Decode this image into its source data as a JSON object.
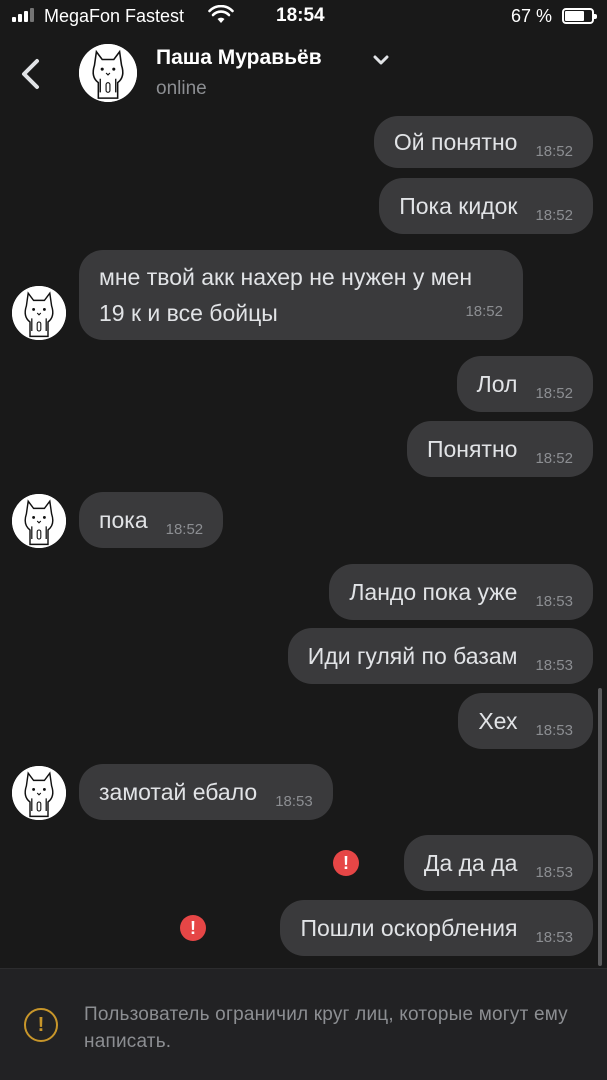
{
  "status_bar": {
    "carrier": "MegaFon Fastest",
    "time": "18:54",
    "battery": "67 %",
    "battery_level": 0.67
  },
  "header": {
    "title": "Паша Муравьёв",
    "status": "online"
  },
  "messages": [
    {
      "dir": "out",
      "text": "Ой понятно",
      "time": "18:52"
    },
    {
      "dir": "out",
      "text": "Пока кидок",
      "time": "18:52"
    },
    {
      "dir": "in",
      "text": "мне твой акк нахер не нужен у мен 19 к и все бойцы",
      "time": "18:52"
    },
    {
      "dir": "out",
      "text": "Лол",
      "time": "18:52"
    },
    {
      "dir": "out",
      "text": "Понятно",
      "time": "18:52"
    },
    {
      "dir": "in",
      "text": "пока",
      "time": "18:52"
    },
    {
      "dir": "out",
      "text": "Ландо пока уже",
      "time": "18:53"
    },
    {
      "dir": "out",
      "text": "Иди гуляй по базам",
      "time": "18:53"
    },
    {
      "dir": "out",
      "text": "Хех",
      "time": "18:53"
    },
    {
      "dir": "in",
      "text": "замотай ебало",
      "time": "18:53"
    },
    {
      "dir": "out",
      "text": "Да да да",
      "time": "18:53",
      "error": true
    },
    {
      "dir": "out",
      "text": "Пошли оскорбления",
      "time": "18:53",
      "error": true
    }
  ],
  "icons": {
    "error": "!",
    "warning": "!"
  },
  "footer": {
    "notice": "Пользователь ограничил круг лиц, которые могут ему написать."
  },
  "colors": {
    "background": "#191919",
    "bubble": "#3a3a3c",
    "error": "#e64646",
    "warning": "#c8962a"
  }
}
